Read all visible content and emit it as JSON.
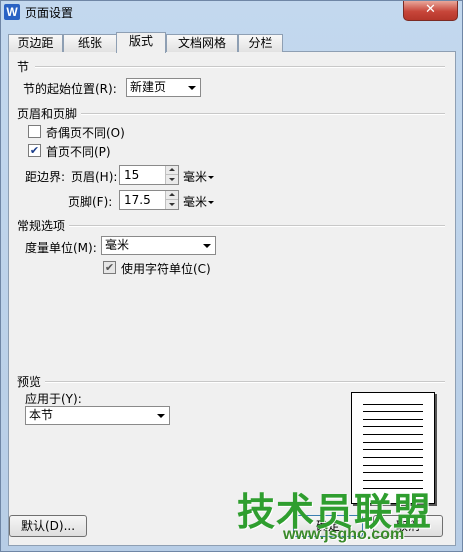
{
  "window": {
    "title": "页面设置",
    "app_icon_letter": "W",
    "close_glyph": "✕"
  },
  "tabs": [
    {
      "label": "页边距"
    },
    {
      "label": "纸张"
    },
    {
      "label": "版式"
    },
    {
      "label": "文档网格"
    },
    {
      "label": "分栏"
    }
  ],
  "section": {
    "group_label": "节",
    "start_label": "节的起始位置(R):",
    "start_value": "新建页"
  },
  "header_footer": {
    "group_label": "页眉和页脚",
    "odd_even_label": "奇偶页不同(O)",
    "odd_even_checked": false,
    "first_page_label": "首页不同(P)",
    "first_page_checked": true,
    "distance_label": "距边界:",
    "header_label": "页眉(H):",
    "header_value": "15",
    "footer_label": "页脚(F):",
    "footer_value": "17.5",
    "unit_label": "毫米"
  },
  "general": {
    "group_label": "常规选项",
    "measure_label": "度量单位(M):",
    "measure_value": "毫米",
    "char_unit_label": "使用字符单位(C)",
    "char_unit_checked": true
  },
  "preview": {
    "group_label": "预览",
    "apply_label": "应用于(Y):",
    "apply_value": "本节"
  },
  "buttons": {
    "default_label": "默认(D)...",
    "ok_label": "确定",
    "cancel_label": "取消"
  },
  "watermark": {
    "big_text": "技术员联盟",
    "small_text": "www.jsgho.com"
  },
  "colors": {
    "accent": "#2a62c4",
    "close": "#c7463a",
    "watermark": "#2f9e2f"
  }
}
